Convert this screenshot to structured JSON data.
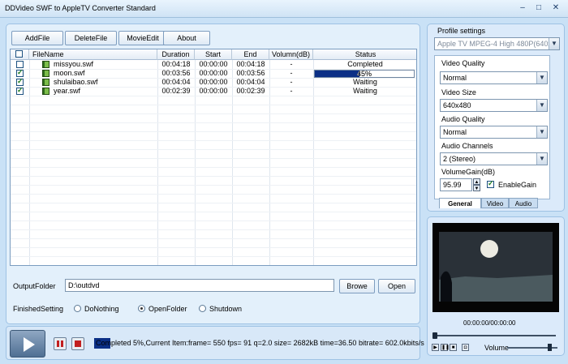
{
  "window": {
    "title": "DDVideo SWF to AppleTV Converter Standard"
  },
  "toolbar": {
    "add_file": "AddFile",
    "delete_file": "DeleteFile",
    "movie_edit": "MovieEdit",
    "about": "About"
  },
  "table": {
    "headers": [
      "FileName",
      "Duration",
      "Start",
      "End",
      "Volumn(dB)",
      "Status"
    ],
    "rows": [
      {
        "checked": false,
        "file": "missyou.swf",
        "duration": "00:04:18",
        "start": "00:00:00",
        "end": "00:04:18",
        "volume": "-",
        "status": "Completed"
      },
      {
        "checked": true,
        "file": "moon.swf",
        "duration": "00:03:56",
        "start": "00:00:00",
        "end": "00:03:56",
        "volume": "-",
        "status": "45%",
        "progress": 45
      },
      {
        "checked": true,
        "file": "shulaibao.swf",
        "duration": "00:04:04",
        "start": "00:00:00",
        "end": "00:04:04",
        "volume": "-",
        "status": "Waiting"
      },
      {
        "checked": true,
        "file": "year.swf",
        "duration": "00:02:39",
        "start": "00:00:00",
        "end": "00:02:39",
        "volume": "-",
        "status": "Waiting"
      }
    ]
  },
  "output": {
    "label": "OutputFolder",
    "path": "D:\\outdvd",
    "browse": "Browe",
    "open": "Open"
  },
  "finished": {
    "label": "FinishedSetting",
    "options": [
      "DoNothing",
      "OpenFolder",
      "Shutdown"
    ],
    "selected": "OpenFolder"
  },
  "profile": {
    "title": "Profile settings",
    "selected": "Apple TV MPEG-4 High 480P(640x480)",
    "video_quality_label": "Video Quality",
    "video_quality": "Normal",
    "video_size_label": "Video Size",
    "video_size": "640x480",
    "audio_quality_label": "Audio Quality",
    "audio_quality": "Normal",
    "audio_channels_label": "Audio Channels",
    "audio_channels": "2 (Stereo)",
    "volume_gain_label": "VolumeGain(dB)",
    "volume_gain": "95.99",
    "enable_gain_label": "EnableGain",
    "tabs": [
      "General",
      "Video",
      "Audio"
    ]
  },
  "preview": {
    "time": "00:00:00/00:00:00",
    "volume_label": "Volume"
  },
  "status": {
    "text": "Completed 5%,Current Item:frame=  550 fps= 91 q=2.0 size=    2682kB time=36.50 bitrate= 602.0kbits/s",
    "progress_percent": 5
  },
  "colors": {
    "background": "#c9e1f6",
    "progress": "#0b2f86",
    "accent": "#1c5180"
  }
}
